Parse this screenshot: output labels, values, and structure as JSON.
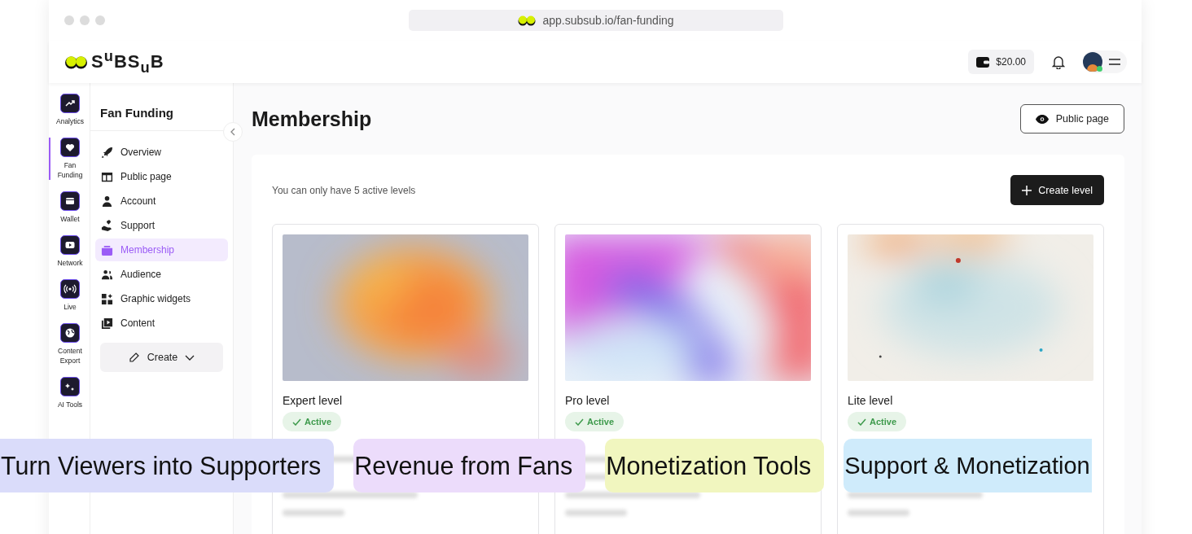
{
  "browser": {
    "url": "app.subsub.io/fan-funding"
  },
  "header": {
    "logo": "S$^{u}$BS$_{u}$B",
    "balance": "$20.00",
    "online": true
  },
  "rail": [
    {
      "label": "Analytics",
      "selected": false
    },
    {
      "label": "Fan Funding",
      "selected": true
    },
    {
      "label": "Wallet",
      "selected": false
    },
    {
      "label": "Network",
      "selected": false
    },
    {
      "label": "Live",
      "selected": false
    },
    {
      "label": "Content Export",
      "selected": false
    },
    {
      "label": "AI Tools",
      "selected": false
    }
  ],
  "subnav": {
    "title": "Fan Funding",
    "items": [
      {
        "label": "Overview",
        "selected": false
      },
      {
        "label": "Public page",
        "selected": false
      },
      {
        "label": "Account",
        "selected": false
      },
      {
        "label": "Support",
        "selected": false
      },
      {
        "label": "Membership",
        "selected": true
      },
      {
        "label": "Audience",
        "selected": false
      },
      {
        "label": "Graphic widgets",
        "selected": false
      },
      {
        "label": "Content",
        "selected": false
      }
    ],
    "create": "Create"
  },
  "main": {
    "title": "Membership",
    "public_button": "Public page",
    "note": "You can only have 5 active levels",
    "create_button": "Create level",
    "levels": [
      {
        "name": "Expert level",
        "status": "Active",
        "active": true
      },
      {
        "name": "Pro level",
        "status": "Active",
        "active": true
      },
      {
        "name": "Lite level",
        "status": "Active",
        "active": true
      }
    ]
  },
  "captions": [
    {
      "text": "Turn Viewers into Supporters",
      "color": "#dadcfa"
    },
    {
      "text": "Revenue from Fans",
      "color": "#ecdcfb"
    },
    {
      "text": "Monetization Tools",
      "color": "#f1f6bf"
    },
    {
      "text": "Support & Monetization",
      "color": "#cfebfb"
    }
  ]
}
